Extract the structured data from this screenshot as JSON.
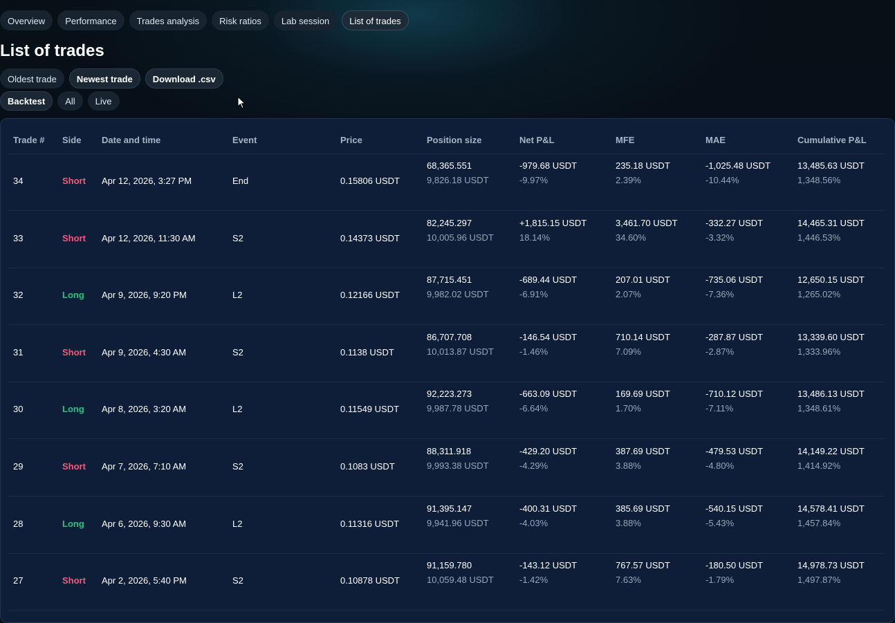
{
  "tabs": [
    {
      "label": "Overview"
    },
    {
      "label": "Performance"
    },
    {
      "label": "Trades analysis"
    },
    {
      "label": "Risk ratios"
    },
    {
      "label": "Lab session"
    },
    {
      "label": "List of trades"
    }
  ],
  "page_title": "List of trades",
  "actions": {
    "oldest": "Oldest trade",
    "newest": "Newest trade",
    "download": "Download .csv"
  },
  "filters": {
    "backtest": "Backtest",
    "all": "All",
    "live": "Live"
  },
  "colors": {
    "short": "#f05b7d",
    "long": "#2fc07e",
    "panel": "#0f1e38"
  },
  "table": {
    "columns": [
      "Trade #",
      "Side",
      "Date and time",
      "Event",
      "Price",
      "Position size",
      "Net P&L",
      "MFE",
      "MAE",
      "Cumulative P&L"
    ],
    "rows": [
      {
        "trade": "34",
        "side": "Short",
        "datetime": "Apr 12, 2026, 3:27 PM",
        "event": "End",
        "price": "0.15806 USDT",
        "pos_qty": "68,365.551",
        "pos_val": "9,826.18 USDT",
        "pnl": "-979.68 USDT",
        "pnl_pct": "-9.97%",
        "mfe": "235.18 USDT",
        "mfe_pct": "2.39%",
        "mae": "-1,025.48 USDT",
        "mae_pct": "-10.44%",
        "cum": "13,485.63 USDT",
        "cum_pct": "1,348.56%"
      },
      {
        "trade": "33",
        "side": "Short",
        "datetime": "Apr 12, 2026, 11:30 AM",
        "event": "S2",
        "price": "0.14373 USDT",
        "pos_qty": "82,245.297",
        "pos_val": "10,005.96 USDT",
        "pnl": "+1,815.15 USDT",
        "pnl_pct": "18.14%",
        "mfe": "3,461.70 USDT",
        "mfe_pct": "34.60%",
        "mae": "-332.27 USDT",
        "mae_pct": "-3.32%",
        "cum": "14,465.31 USDT",
        "cum_pct": "1,446.53%"
      },
      {
        "trade": "32",
        "side": "Long",
        "datetime": "Apr 9, 2026, 9:20 PM",
        "event": "L2",
        "price": "0.12166 USDT",
        "pos_qty": "87,715.451",
        "pos_val": "9,982.02 USDT",
        "pnl": "-689.44 USDT",
        "pnl_pct": "-6.91%",
        "mfe": "207.01 USDT",
        "mfe_pct": "2.07%",
        "mae": "-735.06 USDT",
        "mae_pct": "-7.36%",
        "cum": "12,650.15 USDT",
        "cum_pct": "1,265.02%"
      },
      {
        "trade": "31",
        "side": "Short",
        "datetime": "Apr 9, 2026, 4:30 AM",
        "event": "S2",
        "price": "0.1138 USDT",
        "pos_qty": "86,707.708",
        "pos_val": "10,013.87 USDT",
        "pnl": "-146.54 USDT",
        "pnl_pct": "-1.46%",
        "mfe": "710.14 USDT",
        "mfe_pct": "7.09%",
        "mae": "-287.87 USDT",
        "mae_pct": "-2.87%",
        "cum": "13,339.60 USDT",
        "cum_pct": "1,333.96%"
      },
      {
        "trade": "30",
        "side": "Long",
        "datetime": "Apr 8, 2026, 3:20 AM",
        "event": "L2",
        "price": "0.11549 USDT",
        "pos_qty": "92,223.273",
        "pos_val": "9,987.78 USDT",
        "pnl": "-663.09 USDT",
        "pnl_pct": "-6.64%",
        "mfe": "169.69 USDT",
        "mfe_pct": "1.70%",
        "mae": "-710.12 USDT",
        "mae_pct": "-7.11%",
        "cum": "13,486.13 USDT",
        "cum_pct": "1,348.61%"
      },
      {
        "trade": "29",
        "side": "Short",
        "datetime": "Apr 7, 2026, 7:10 AM",
        "event": "S2",
        "price": "0.1083 USDT",
        "pos_qty": "88,311.918",
        "pos_val": "9,993.38 USDT",
        "pnl": "-429.20 USDT",
        "pnl_pct": "-4.29%",
        "mfe": "387.69 USDT",
        "mfe_pct": "3.88%",
        "mae": "-479.53 USDT",
        "mae_pct": "-4.80%",
        "cum": "14,149.22 USDT",
        "cum_pct": "1,414.92%"
      },
      {
        "trade": "28",
        "side": "Long",
        "datetime": "Apr 6, 2026, 9:30 AM",
        "event": "L2",
        "price": "0.11316 USDT",
        "pos_qty": "91,395.147",
        "pos_val": "9,941.96 USDT",
        "pnl": "-400.31 USDT",
        "pnl_pct": "-4.03%",
        "mfe": "385.69 USDT",
        "mfe_pct": "3.88%",
        "mae": "-540.15 USDT",
        "mae_pct": "-5.43%",
        "cum": "14,578.41 USDT",
        "cum_pct": "1,457.84%"
      },
      {
        "trade": "27",
        "side": "Short",
        "datetime": "Apr 2, 2026, 5:40 PM",
        "event": "S2",
        "price": "0.10878 USDT",
        "pos_qty": "91,159.780",
        "pos_val": "10,059.48 USDT",
        "pnl": "-143.12 USDT",
        "pnl_pct": "-1.42%",
        "mfe": "767.57 USDT",
        "mfe_pct": "7.63%",
        "mae": "-180.50 USDT",
        "mae_pct": "-1.79%",
        "cum": "14,978.73 USDT",
        "cum_pct": "1,497.87%"
      }
    ]
  }
}
